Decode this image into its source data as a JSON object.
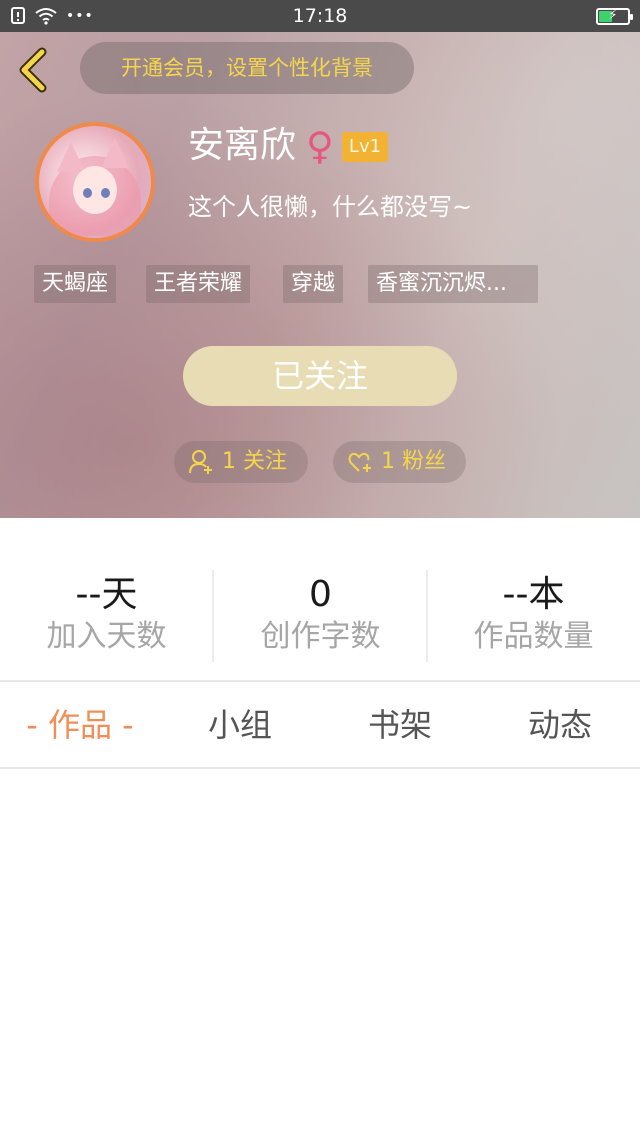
{
  "status_bar": {
    "time": "17:18",
    "left_icons": [
      "notification-icon",
      "wifi-icon",
      "more-dots-icon"
    ],
    "more_dots": "•••",
    "battery_level": 0.45,
    "battery_charging": true
  },
  "header": {
    "back_icon": "chevron-left-icon",
    "member_promo": "开通会员，设置个性化背景",
    "username": "安离欣",
    "gender_symbol": "♀",
    "level_badge": "Lv1",
    "bio": "这个人很懒，什么都没写~",
    "tags": [
      "天蝎座",
      "王者荣耀",
      "穿越",
      "香蜜沉沉烬..."
    ],
    "follow_button": "已关注",
    "following": {
      "icon": "person-add-icon",
      "label": "1 关注"
    },
    "followers": {
      "icon": "heart-plus-icon",
      "label": "1 粉丝"
    }
  },
  "stats": [
    {
      "value": "--天",
      "label": "加入天数"
    },
    {
      "value": "0",
      "label": "创作字数"
    },
    {
      "value": "--本",
      "label": "作品数量"
    }
  ],
  "tabs": [
    {
      "label": "- 作品 -",
      "active": true
    },
    {
      "label": "小组",
      "active": false
    },
    {
      "label": "书架",
      "active": false
    },
    {
      "label": "动态",
      "active": false
    }
  ],
  "colors": {
    "accent_orange": "#f28e55",
    "gold_text": "#f5d64a",
    "level_badge": "#f2b233",
    "follow_button": "#e8dcb4",
    "gender_pink": "#e5577c",
    "status_bar": "#4a4a4a"
  }
}
